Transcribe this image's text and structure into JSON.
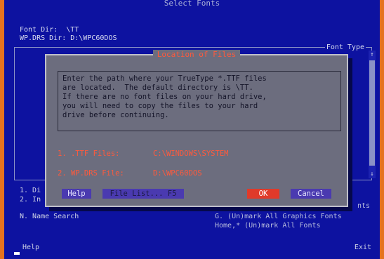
{
  "window": {
    "title": "Select Fonts"
  },
  "info": {
    "font_dir": "Font Dir:  \\TT",
    "wp_drs_dir": "WP.DRS Dir: D:\\WPC60DOS"
  },
  "panel": {
    "label": "Font Type"
  },
  "background_options": {
    "line1": "1. Di",
    "line2": "2. In",
    "line3": "N. Name Search",
    "right1": "nts",
    "right2": "G. (Un)mark All Graphics Fonts",
    "right3": "Home,* (Un)mark All Fonts"
  },
  "dialog": {
    "title": "Location of Files",
    "message": [
      "Enter the path where your TrueType *.TTF files",
      "are located.  The default directory is \\TT.",
      "If there are no font files on your hard drive,",
      "you will need to copy the files to your hard",
      "drive before continuing."
    ],
    "fields": [
      {
        "label": "1. .TTF Files:",
        "value": "C:\\WINDOWS\\SYSTEM"
      },
      {
        "label": "2. WP.DRS File:",
        "value": "D:\\WPC60DOS"
      }
    ],
    "buttons": {
      "help": "Help",
      "file_list": "File List... F5",
      "ok": "OK",
      "cancel": "Cancel"
    }
  },
  "status_bar": {
    "help": "Help",
    "exit": "Exit"
  },
  "colors": {
    "screen_bg": "#0d12a0",
    "dialog_bg": "#6c6d7e",
    "accent_red": "#ff5a3c",
    "frame_orange": "#e5731f"
  }
}
